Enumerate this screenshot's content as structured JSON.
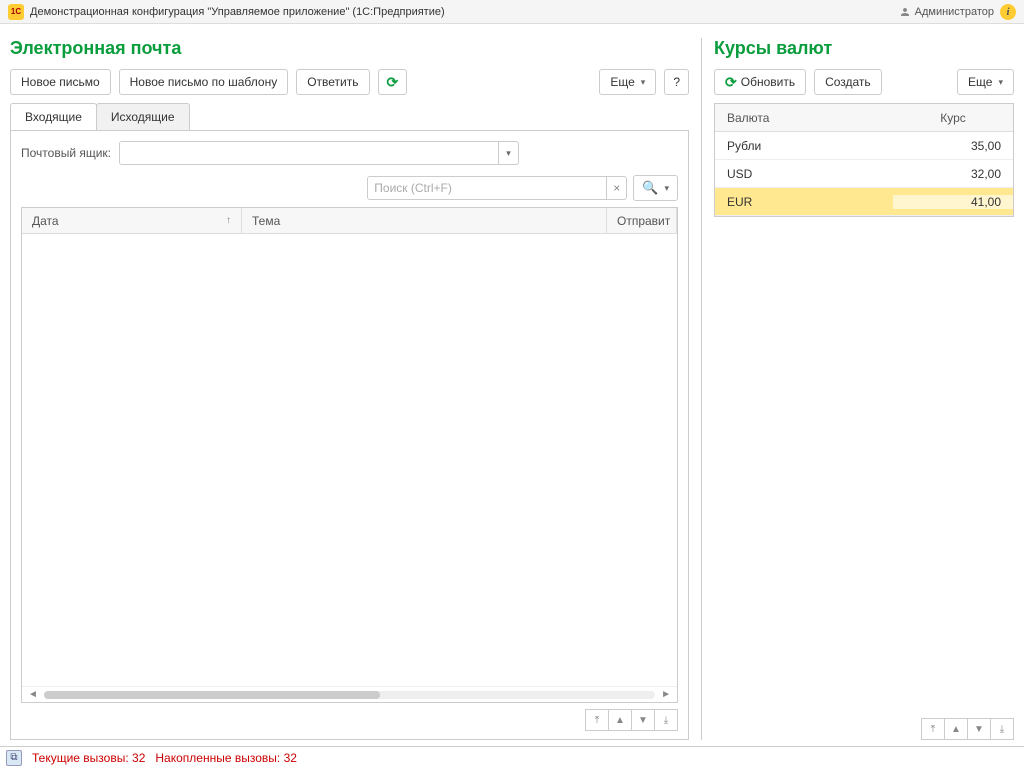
{
  "titlebar": {
    "logo_text": "1C",
    "title": "Демонстрационная конфигурация \"Управляемое приложение\"  (1С:Предприятие)",
    "user": "Администратор",
    "info": "i"
  },
  "email": {
    "title": "Электронная почта",
    "buttons": {
      "new": "Новое письмо",
      "new_template": "Новое письмо по шаблону",
      "reply": "Ответить",
      "more": "Еще",
      "help": "?"
    },
    "tabs": {
      "inbox": "Входящие",
      "outbox": "Исходящие"
    },
    "mailbox_label": "Почтовый ящик:",
    "mailbox_value": "",
    "search_placeholder": "Поиск (Ctrl+F)",
    "columns": {
      "date": "Дата",
      "topic": "Тема",
      "sender": "Отправит"
    }
  },
  "rates": {
    "title": "Курсы валют",
    "buttons": {
      "refresh": "Обновить",
      "create": "Создать",
      "more": "Еще"
    },
    "columns": {
      "currency": "Валюта",
      "rate": "Курс"
    },
    "rows": [
      {
        "name": "Рубли",
        "rate": "35,00",
        "selected": false
      },
      {
        "name": "USD",
        "rate": "32,00",
        "selected": false
      },
      {
        "name": "EUR",
        "rate": "41,00",
        "selected": true
      }
    ]
  },
  "status": {
    "current_label": "Текущие вызовы:",
    "current_value": "32",
    "accum_label": "Накопленные вызовы:",
    "accum_value": "32"
  }
}
